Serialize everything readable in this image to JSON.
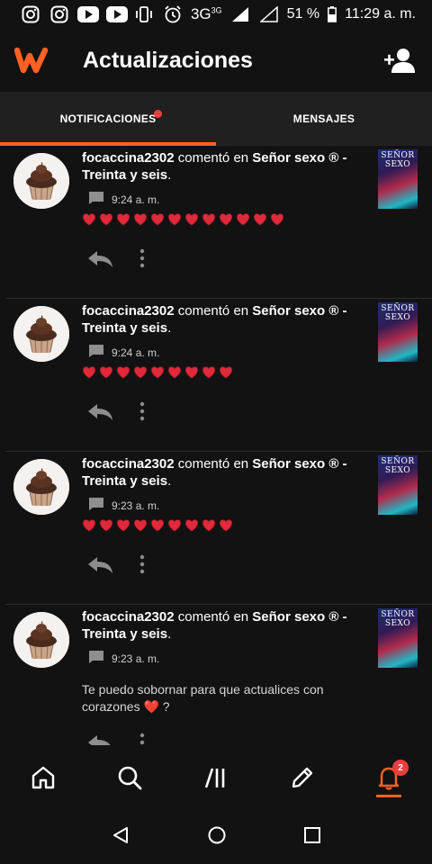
{
  "status_bar": {
    "network": "3G",
    "network_sup": "3G",
    "battery": "51 %",
    "time": "11:29 a. m.",
    "icons": [
      "instagram-icon",
      "instagram-icon",
      "youtube-icon",
      "youtube-icon",
      "vibrate-icon",
      "alarm-icon",
      "signal-icon",
      "battery-icon"
    ]
  },
  "app_bar": {
    "title": "Actualizaciones",
    "logo": "wattpad-logo",
    "action_icon": "add-friend-icon"
  },
  "tabs": [
    {
      "label": "NOTIFICACIONES",
      "active": true,
      "has_dot": true
    },
    {
      "label": "MENSAJES",
      "active": false,
      "has_dot": false
    }
  ],
  "notifications": [
    {
      "user": "focaccina2302",
      "action": " comentó en ",
      "story": "Señor sexo ® - Treinta y seis",
      "suffix": ".",
      "time": "9:24 a. m.",
      "hearts": 12,
      "message": "",
      "cover_title": "SEÑOR SEXO"
    },
    {
      "user": "focaccina2302",
      "action": " comentó en ",
      "story": "Señor sexo ® - Treinta y seis",
      "suffix": ".",
      "time": "9:24 a. m.",
      "hearts": 9,
      "message": "",
      "cover_title": "SEÑOR SEXO"
    },
    {
      "user": "focaccina2302",
      "action": " comentó en ",
      "story": "Señor sexo ® - Treinta y seis",
      "suffix": ".",
      "time": "9:23 a. m.",
      "hearts": 9,
      "message": "",
      "cover_title": "SEÑOR SEXO"
    },
    {
      "user": "focaccina2302",
      "action": " comentó en ",
      "story": "Señor sexo ® - Treinta y seis",
      "suffix": ".",
      "time": "9:23 a. m.",
      "hearts": 0,
      "message": "Te puedo sobornar para que actualices con corazones ❤️ ?",
      "cover_title": "SEÑOR SEXO"
    }
  ],
  "bottom_nav": [
    {
      "name": "home",
      "icon": "home-icon",
      "active": false
    },
    {
      "name": "search",
      "icon": "search-icon",
      "active": false
    },
    {
      "name": "library",
      "icon": "library-icon",
      "active": false
    },
    {
      "name": "write",
      "icon": "pencil-icon",
      "active": false
    },
    {
      "name": "notifications",
      "icon": "bell-icon",
      "active": true,
      "badge": "2"
    }
  ],
  "colors": {
    "accent": "#ff6122",
    "heart": "#e0293a",
    "badge": "#e93f3f",
    "background": "#121212"
  }
}
